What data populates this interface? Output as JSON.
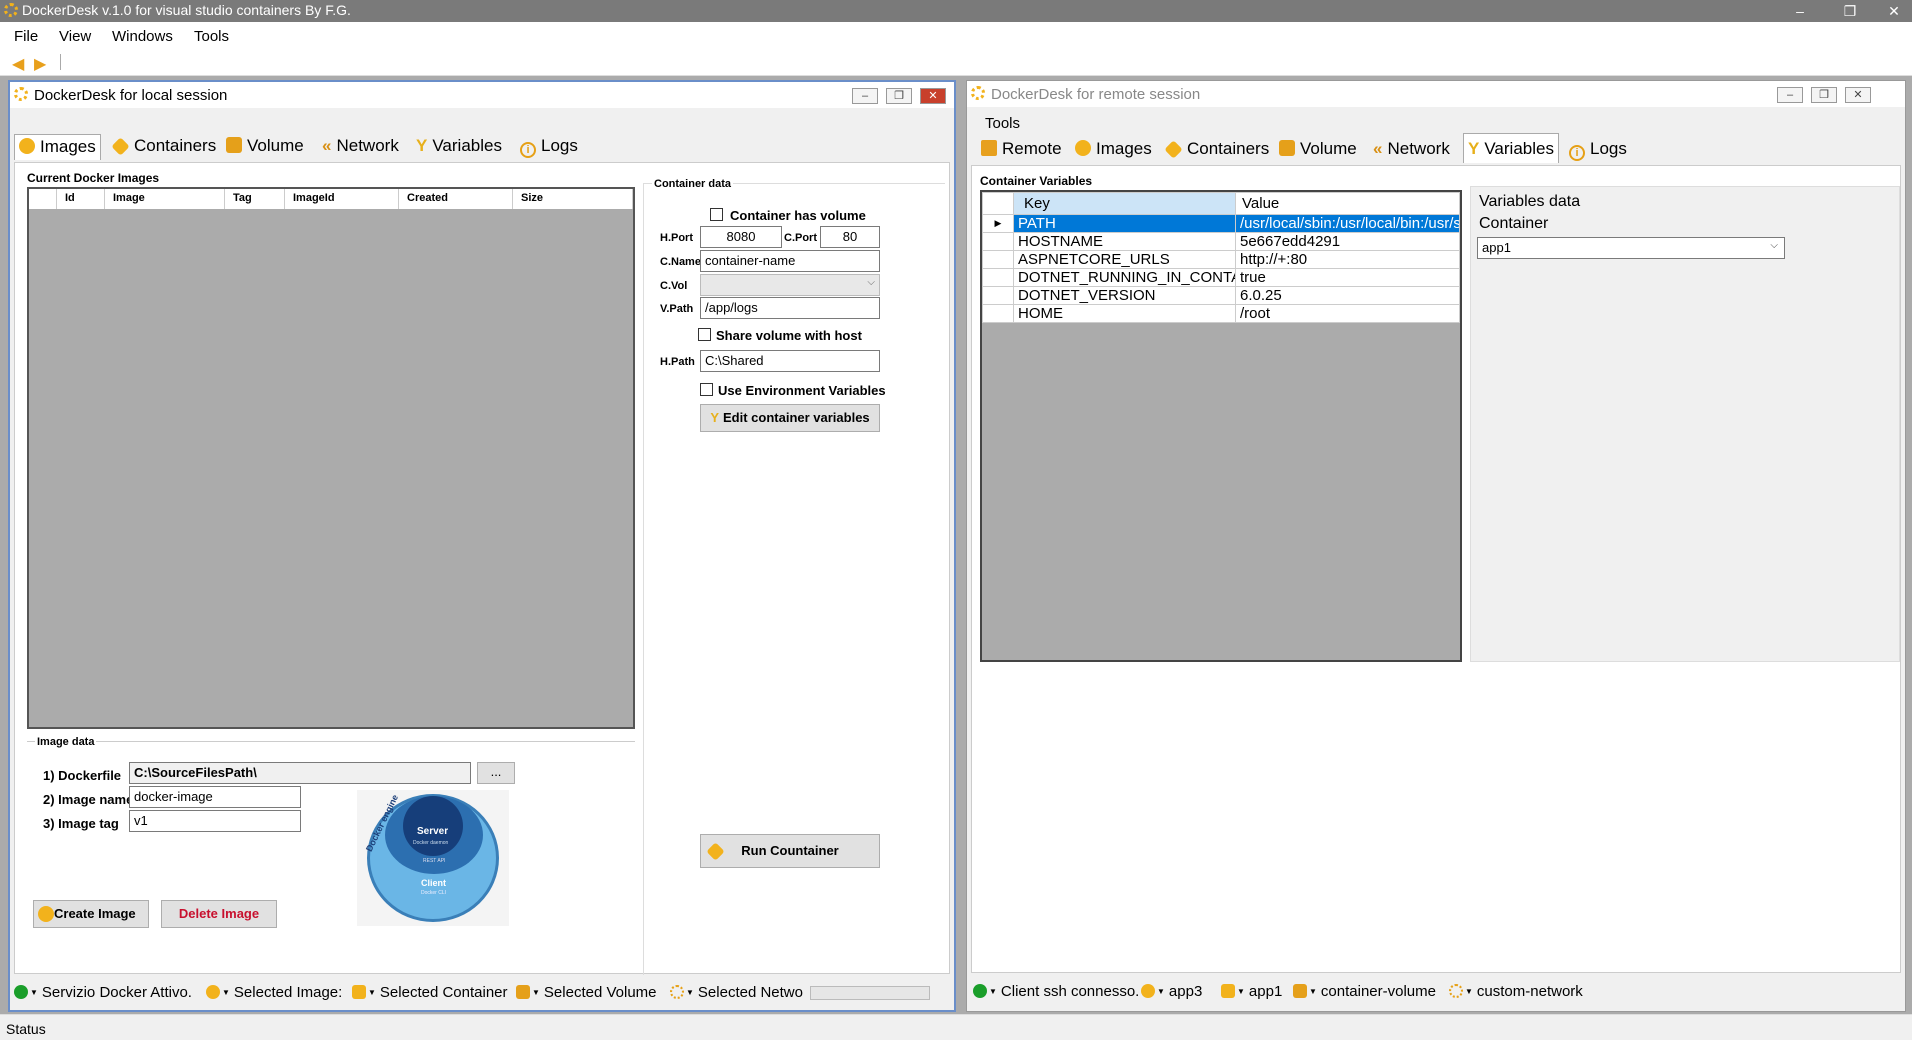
{
  "app_title": "DockerDesk v.1.0 for visual studio containers By F.G.",
  "window_controls": {
    "minimize": "–",
    "restore": "❐",
    "close": "✕"
  },
  "menu": [
    "File",
    "View",
    "Windows",
    "Tools"
  ],
  "status": "Status",
  "local": {
    "title": "DockerDesk for local session",
    "tabs": [
      "Images",
      "Containers",
      "Volume",
      "Network",
      "Variables",
      "Logs"
    ],
    "active_tab": "Images",
    "images_group": "Current Docker Images",
    "images_columns": [
      "Id",
      "Image",
      "Tag",
      "ImageId",
      "Created",
      "Size"
    ],
    "container_data": {
      "group": "Container data",
      "has_volume_label": "Container has volume",
      "hport_label": "H.Port",
      "hport": "8080",
      "cport_label": "C.Port",
      "cport": "80",
      "cname_label": "C.Name",
      "cname": "container-name",
      "cvol_label": "C.Vol",
      "cvol": "",
      "vpath_label": "V.Path",
      "vpath": "/app/logs",
      "share_label": "Share volume with host",
      "hpath_label": "H.Path",
      "hpath": "C:\\Shared",
      "env_label": "Use Environment Variables",
      "edit_vars_button": "Edit container variables",
      "run_button": "Run Countainer"
    },
    "image_data": {
      "group": "Image data",
      "dockerfile_label": "1) Dockerfile",
      "dockerfile": "C:\\SourceFilesPath\\",
      "browse_button": "...",
      "name_label": "2) Image name",
      "name": "docker-image",
      "tag_label": "3) Image tag",
      "tag": "v1",
      "create_button": "Create Image",
      "delete_button": "Delete Image",
      "engine": {
        "title": "Docker engine",
        "server": "Server",
        "daemon": "Docker daemon",
        "rest": "REST API",
        "client": "Client",
        "cli": "Docker CLI"
      }
    },
    "status": [
      "Servizio Docker Attivo.",
      "Selected Image:",
      "Selected Container",
      "Selected Volume",
      "Selected Netwo"
    ]
  },
  "remote": {
    "title": "DockerDesk for remote session",
    "menu": "Tools",
    "tabs": [
      "Remote",
      "Images",
      "Containers",
      "Volume",
      "Network",
      "Variables",
      "Logs"
    ],
    "active_tab": "Variables",
    "vars_group": "Container Variables",
    "columns": [
      "Key",
      "Value"
    ],
    "rows": [
      {
        "key": "PATH",
        "value": "/usr/local/sbin:/usr/local/bin:/usr/sbin..."
      },
      {
        "key": "HOSTNAME",
        "value": "5e667edd4291"
      },
      {
        "key": "ASPNETCORE_URLS",
        "value": "http://+:80"
      },
      {
        "key": "DOTNET_RUNNING_IN_CONTAI...",
        "value": "true"
      },
      {
        "key": "DOTNET_VERSION",
        "value": "6.0.25"
      },
      {
        "key": "HOME",
        "value": "/root"
      }
    ],
    "vars_data": {
      "group": "Variables data",
      "container_label": "Container",
      "container": "app1"
    },
    "status": [
      "Client ssh connesso.",
      "app3",
      "app1",
      "container-volume",
      "custom-network"
    ]
  },
  "colors": {
    "selection": "#0078d7",
    "grid_bg": "#ababab",
    "accent": "#f2b21c"
  }
}
